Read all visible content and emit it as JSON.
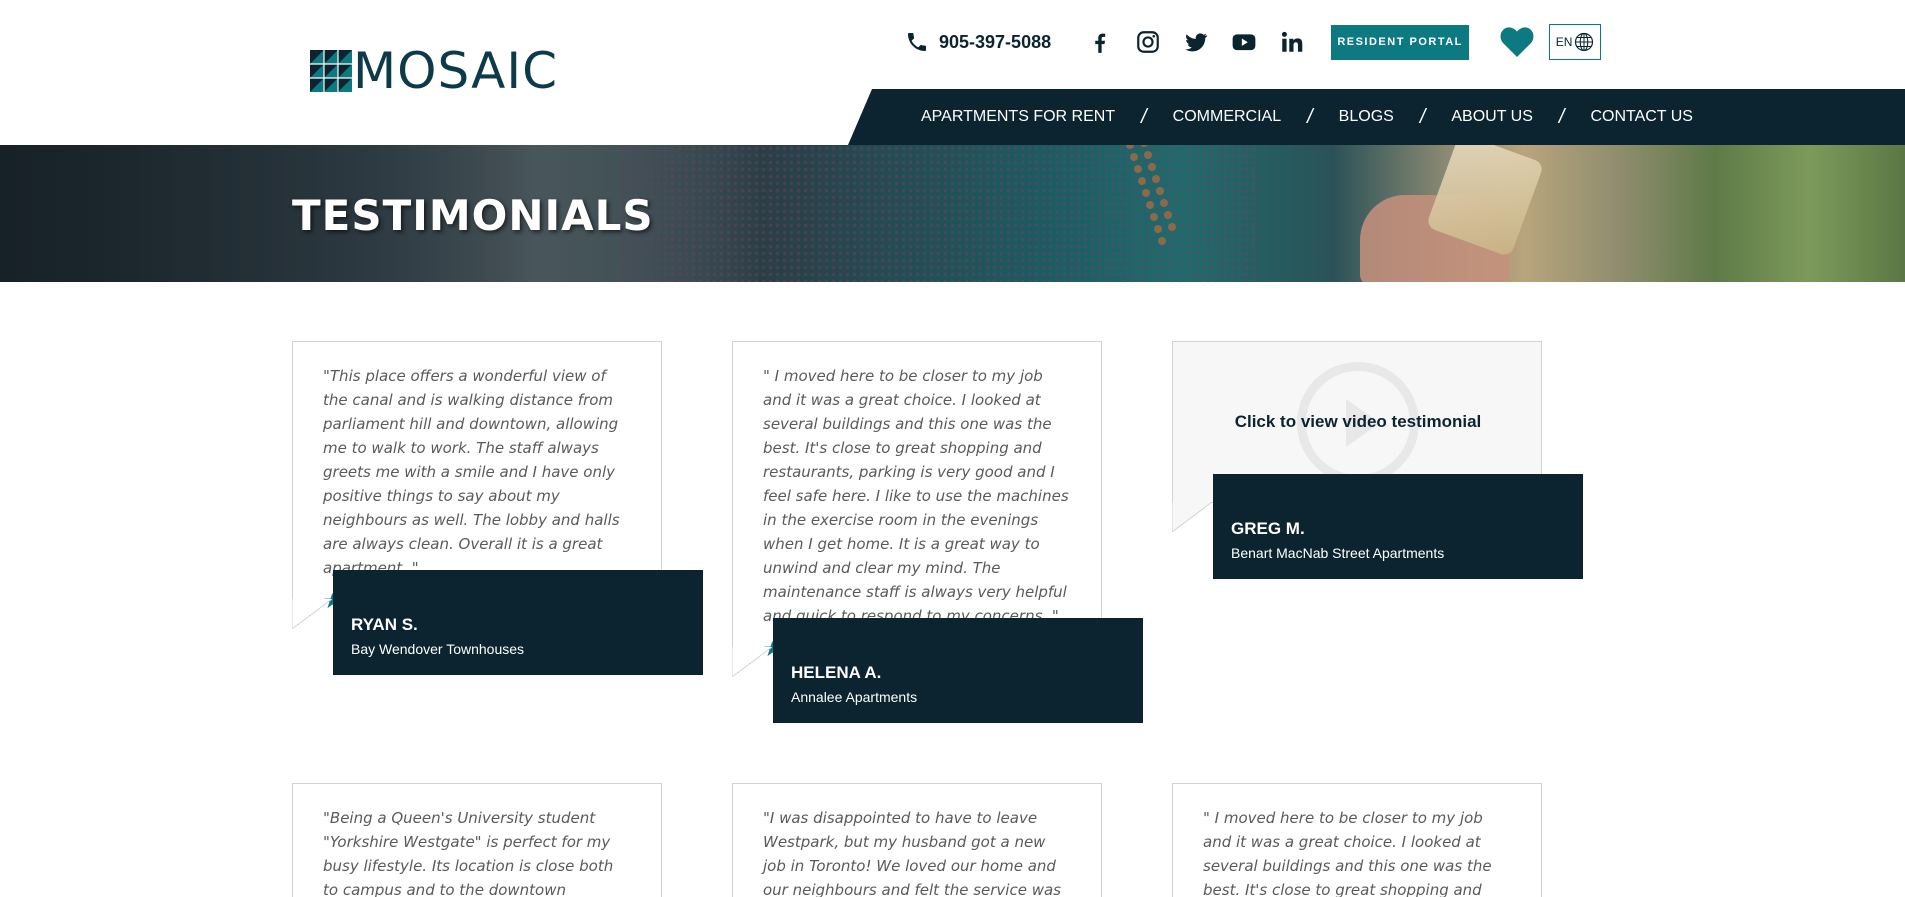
{
  "brand": {
    "name": "MOSAIC",
    "accent": "#0d7a82",
    "dark": "#0b2430"
  },
  "header": {
    "phone": "905-397-5088",
    "social": [
      "facebook-icon",
      "instagram-icon",
      "twitter-icon",
      "youtube-icon",
      "linkedin-icon"
    ],
    "portal_label": "RESIDENT PORTAL",
    "lang_label": "EN"
  },
  "nav": {
    "items": [
      "APARTMENTS FOR RENT",
      "COMMERCIAL",
      "BLOGS",
      "ABOUT US",
      "CONTACT US"
    ],
    "separator": "/"
  },
  "hero": {
    "title": "TESTIMONIALS"
  },
  "testimonials": [
    {
      "quote": "\"This place offers a wonderful view of the canal and is walking distance from parliament hill and downtown, allowing me to walk to work. The staff always greets me with a smile and I have only positive things to say about my neighbours as well. The lobby and halls are always clean. Overall it is a great apartment. \"",
      "stars": 5,
      "name": "RYAN S.",
      "property": "Bay Wendover Townhouses"
    },
    {
      "quote": "\" I moved here to be closer to my job and it was a great choice. I looked at several buildings and this one was the best. It's close to great shopping and restaurants, parking is very good and I feel safe here. I like to use the machines in the exercise room in the evenings when I get home. It is a great way to unwind and clear my mind. The maintenance staff is always very helpful and quick to respond to my concerns. \"",
      "stars": 5,
      "name": "HELENA A.",
      "property": "Annalee Apartments"
    },
    {
      "video_label": "Click to view video testimonial",
      "name": "GREG M.",
      "property": "Benart MacNab Street Apartments"
    },
    {
      "quote": "\"Being a Queen's University student \"Yorkshire Westgate\" is perfect for my busy lifestyle. Its location is close both to campus and to the downtown Kingston area making it"
    },
    {
      "quote": "\"I was disappointed to have to leave Westpark, but my husband got a new job in Toronto! We loved our home and our neighbours and felt the service was always"
    },
    {
      "quote": "\" I moved here to be closer to my job and it was a great choice. I looked at several buildings and this one was the best. It's close to great shopping and restaurants, parking is"
    }
  ]
}
